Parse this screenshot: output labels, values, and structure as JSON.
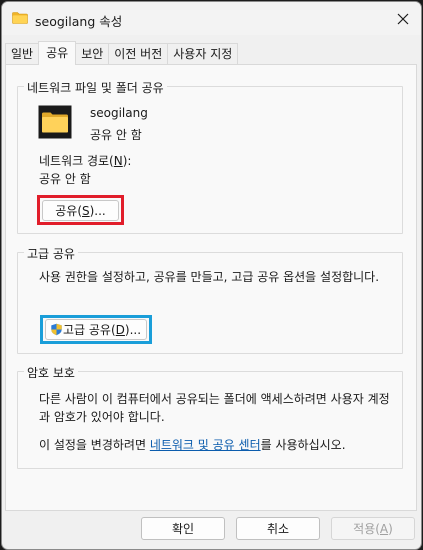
{
  "window": {
    "title": "seogilang 속성"
  },
  "tabs": [
    {
      "label": "일반",
      "active": false
    },
    {
      "label": "공유",
      "active": true
    },
    {
      "label": "보안",
      "active": false
    },
    {
      "label": "이전 버전",
      "active": false
    },
    {
      "label": "사용자 지정",
      "active": false
    }
  ],
  "network_share": {
    "group_title": "네트워크 파일 및 폴더 공유",
    "folder_name": "seogilang",
    "status": "공유 안 함",
    "path_label_prefix": "네트워크 경로(",
    "path_label_key": "N",
    "path_label_suffix": "):",
    "path_value": "공유 안 함",
    "share_button_prefix": "공유(",
    "share_button_key": "S",
    "share_button_suffix": ")..."
  },
  "advanced_share": {
    "group_title": "고급 공유",
    "description": "사용 권한을 설정하고, 공유를 만들고, 고급 공유 옵션을 설정합니다.",
    "button_prefix": "고급 공유(",
    "button_key": "D",
    "button_suffix": ")..."
  },
  "password_protection": {
    "group_title": "암호 보호",
    "description": "다른 사람이 이 컴퓨터에서 공유되는 폴더에 액세스하려면 사용자 계정과 암호가 있어야 합니다.",
    "text_before_link": "이 설정을 변경하려면 ",
    "link_text": "네트워크 및 공유 센터",
    "text_after_link": "를 사용하십시오."
  },
  "footer": {
    "ok_label": "확인",
    "cancel_label": "취소",
    "apply_prefix": "적용(",
    "apply_key": "A",
    "apply_suffix": ")"
  },
  "colors": {
    "highlight_share_button": "#e11d2a",
    "highlight_advanced_button": "#1a9ed9",
    "link": "#0b5cad",
    "folder": "#f2c443"
  }
}
